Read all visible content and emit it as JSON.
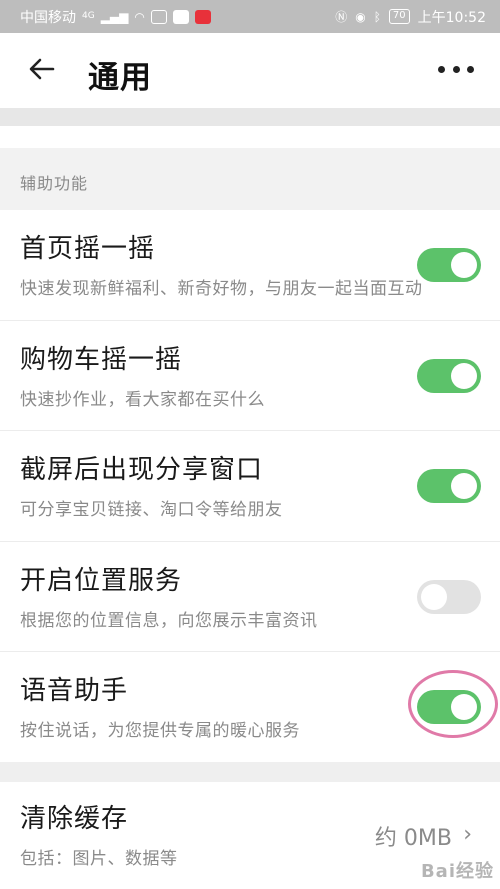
{
  "status_bar": {
    "carrier": "中国移动",
    "network": "4G",
    "battery": "70",
    "time": "上午10:52"
  },
  "header": {
    "title": "通用"
  },
  "section": {
    "title": "辅助功能"
  },
  "settings": [
    {
      "title": "首页摇一摇",
      "description": "快速发现新鲜福利、新奇好物，与朋友一起当面互动",
      "enabled": true
    },
    {
      "title": "购物车摇一摇",
      "description": "快速抄作业，看大家都在买什么",
      "enabled": true
    },
    {
      "title": "截屏后出现分享窗口",
      "description": "可分享宝贝链接、淘口令等给朋友",
      "enabled": true
    },
    {
      "title": "开启位置服务",
      "description": "根据您的位置信息，向您展示丰富资讯",
      "enabled": false
    },
    {
      "title": "语音助手",
      "description": "按住说话，为您提供专属的暖心服务",
      "enabled": true
    }
  ],
  "cache": {
    "title": "清除缓存",
    "description": "包括：图片、数据等",
    "value": "约 0MB"
  },
  "watermark": "Bai经验"
}
